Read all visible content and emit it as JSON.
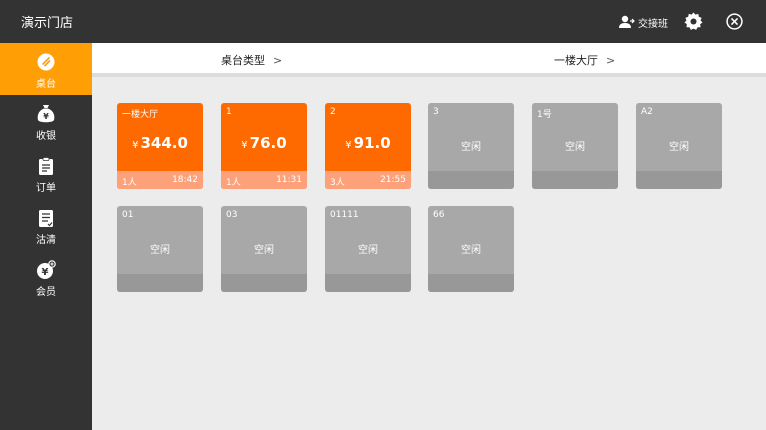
{
  "header": {
    "store_name": "演示门店",
    "shift_label": "交接班"
  },
  "sidebar": {
    "items": [
      {
        "label": "桌台",
        "icon": "table-icon",
        "active": true
      },
      {
        "label": "收银",
        "icon": "money-bag-icon",
        "active": false
      },
      {
        "label": "订单",
        "icon": "order-icon",
        "active": false
      },
      {
        "label": "沽清",
        "icon": "sold-out-icon",
        "active": false
      },
      {
        "label": "会员",
        "icon": "member-icon",
        "active": false
      }
    ]
  },
  "filters": {
    "table_type_label": "桌台类型",
    "area_label": "一楼大厅",
    "chevron": ">"
  },
  "tables": [
    {
      "name": "一楼大厅",
      "status": "busy",
      "currency": "¥",
      "amount": "344.0",
      "guests": "1人",
      "time": "18:42"
    },
    {
      "name": "1",
      "status": "busy",
      "currency": "¥",
      "amount": "76.0",
      "guests": "1人",
      "time": "11:31"
    },
    {
      "name": "2",
      "status": "busy",
      "currency": "¥",
      "amount": "91.0",
      "guests": "3人",
      "time": "21:55"
    },
    {
      "name": "3",
      "status": "idle",
      "state": "空闲"
    },
    {
      "name": "1号",
      "status": "idle",
      "state": "空闲"
    },
    {
      "name": "A2",
      "status": "idle",
      "state": "空闲"
    },
    {
      "name": "01",
      "status": "idle",
      "state": "空闲"
    },
    {
      "name": "03",
      "status": "idle",
      "state": "空闲"
    },
    {
      "name": "01111",
      "status": "idle",
      "state": "空闲"
    },
    {
      "name": "66",
      "status": "idle",
      "state": "空闲"
    }
  ],
  "colors": {
    "accent": "#ff9f05",
    "busy_tile": "#ff6a00",
    "idle_tile": "#a8a8a8",
    "dark": "#333333"
  }
}
